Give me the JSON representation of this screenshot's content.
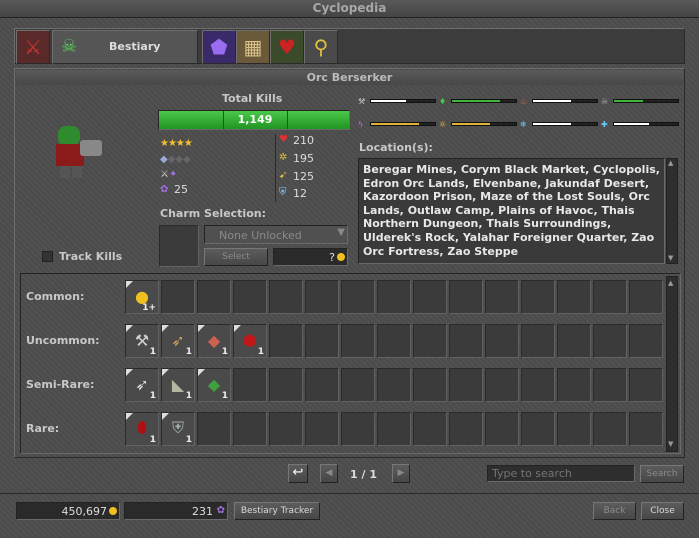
{
  "window": {
    "title": "Cyclopedia"
  },
  "tabs": {
    "bestiary": "Bestiary"
  },
  "creature": {
    "name": "Orc Berserker",
    "total_kills_label": "Total Kills",
    "total_kills": "1,149",
    "kill_progress": 1.0,
    "difficulty_stars": 4,
    "occurrence_diamonds": 1,
    "charm_points": "25",
    "hitpoints": "210",
    "experience": "195",
    "speed": "125",
    "armor": "12",
    "track_kills_label": "Track Kills",
    "location_label": "Location(s):",
    "locations": "Beregar Mines, Corym Black Market, Cyclopolis, Edron Orc Lands, Elvenbane, Jakundaf Desert, Kazordoon Prison, Maze of the Lost Souls, Orc Lands, Outlaw Camp, Plains of Havoc, Thais Northern Dungeon, Thais Surroundings, Ulderek's Rock, Yalahar Foreigner Quarter, Zao Orc Fortress, Zao Steppe"
  },
  "resistances": [
    {
      "icon": "physical-icon",
      "value": 0.55,
      "color": "#ffffff"
    },
    {
      "icon": "earth-icon",
      "value": 0.75,
      "color": "#3fb53f"
    },
    {
      "icon": "fire-icon",
      "value": 0.6,
      "color": "#ffffff"
    },
    {
      "icon": "death-icon",
      "value": 0.45,
      "color": "#3fb53f"
    },
    {
      "icon": "energy-icon",
      "value": 0.75,
      "color": "#e0b23a"
    },
    {
      "icon": "holy-icon",
      "value": 0.6,
      "color": "#e0b23a"
    },
    {
      "icon": "ice-icon",
      "value": 0.6,
      "color": "#ffffff"
    },
    {
      "icon": "heal-icon",
      "value": 0.55,
      "color": "#ffffff"
    }
  ],
  "charm": {
    "label": "Charm Selection:",
    "dropdown": "None Unlocked",
    "select_button": "Select",
    "cost": "?"
  },
  "loot": {
    "rows": [
      {
        "label": "Common:",
        "items": [
          {
            "icon": "gold-coin-icon",
            "glyph": "●",
            "color": "#f0c020",
            "count": "1+"
          }
        ]
      },
      {
        "label": "Uncommon:",
        "items": [
          {
            "icon": "axe-icon",
            "glyph": "⚒",
            "color": "#d0d0d0",
            "count": "1"
          },
          {
            "icon": "spear-icon",
            "glyph": "➶",
            "color": "#c8a060",
            "count": "1"
          },
          {
            "icon": "ham-icon",
            "glyph": "◆",
            "color": "#d06050",
            "count": "1"
          },
          {
            "icon": "red-shield-icon",
            "glyph": "⬢",
            "color": "#c01818",
            "count": "1"
          }
        ]
      },
      {
        "label": "Semi-Rare:",
        "items": [
          {
            "icon": "halberd-icon",
            "glyph": "➶",
            "color": "#e0e0e0",
            "count": "1"
          },
          {
            "icon": "leather-icon",
            "glyph": "◣",
            "color": "#b0b8a0",
            "count": "1"
          },
          {
            "icon": "orc-leather-icon",
            "glyph": "◆",
            "color": "#40a040",
            "count": "1"
          }
        ]
      },
      {
        "label": "Rare:",
        "items": [
          {
            "icon": "red-flask-icon",
            "glyph": "⬮",
            "color": "#b01010",
            "count": "1"
          },
          {
            "icon": "chain-armor-icon",
            "glyph": "⛨",
            "color": "#a0b0b0",
            "count": "1"
          }
        ]
      }
    ]
  },
  "pagination": {
    "page": "1 / 1",
    "search_placeholder": "Type to search",
    "search_button": "Search"
  },
  "footer": {
    "gold": "450,697",
    "charm_points": "231",
    "tracker_button": "Bestiary Tracker",
    "back_button": "Back",
    "close_button": "Close"
  }
}
